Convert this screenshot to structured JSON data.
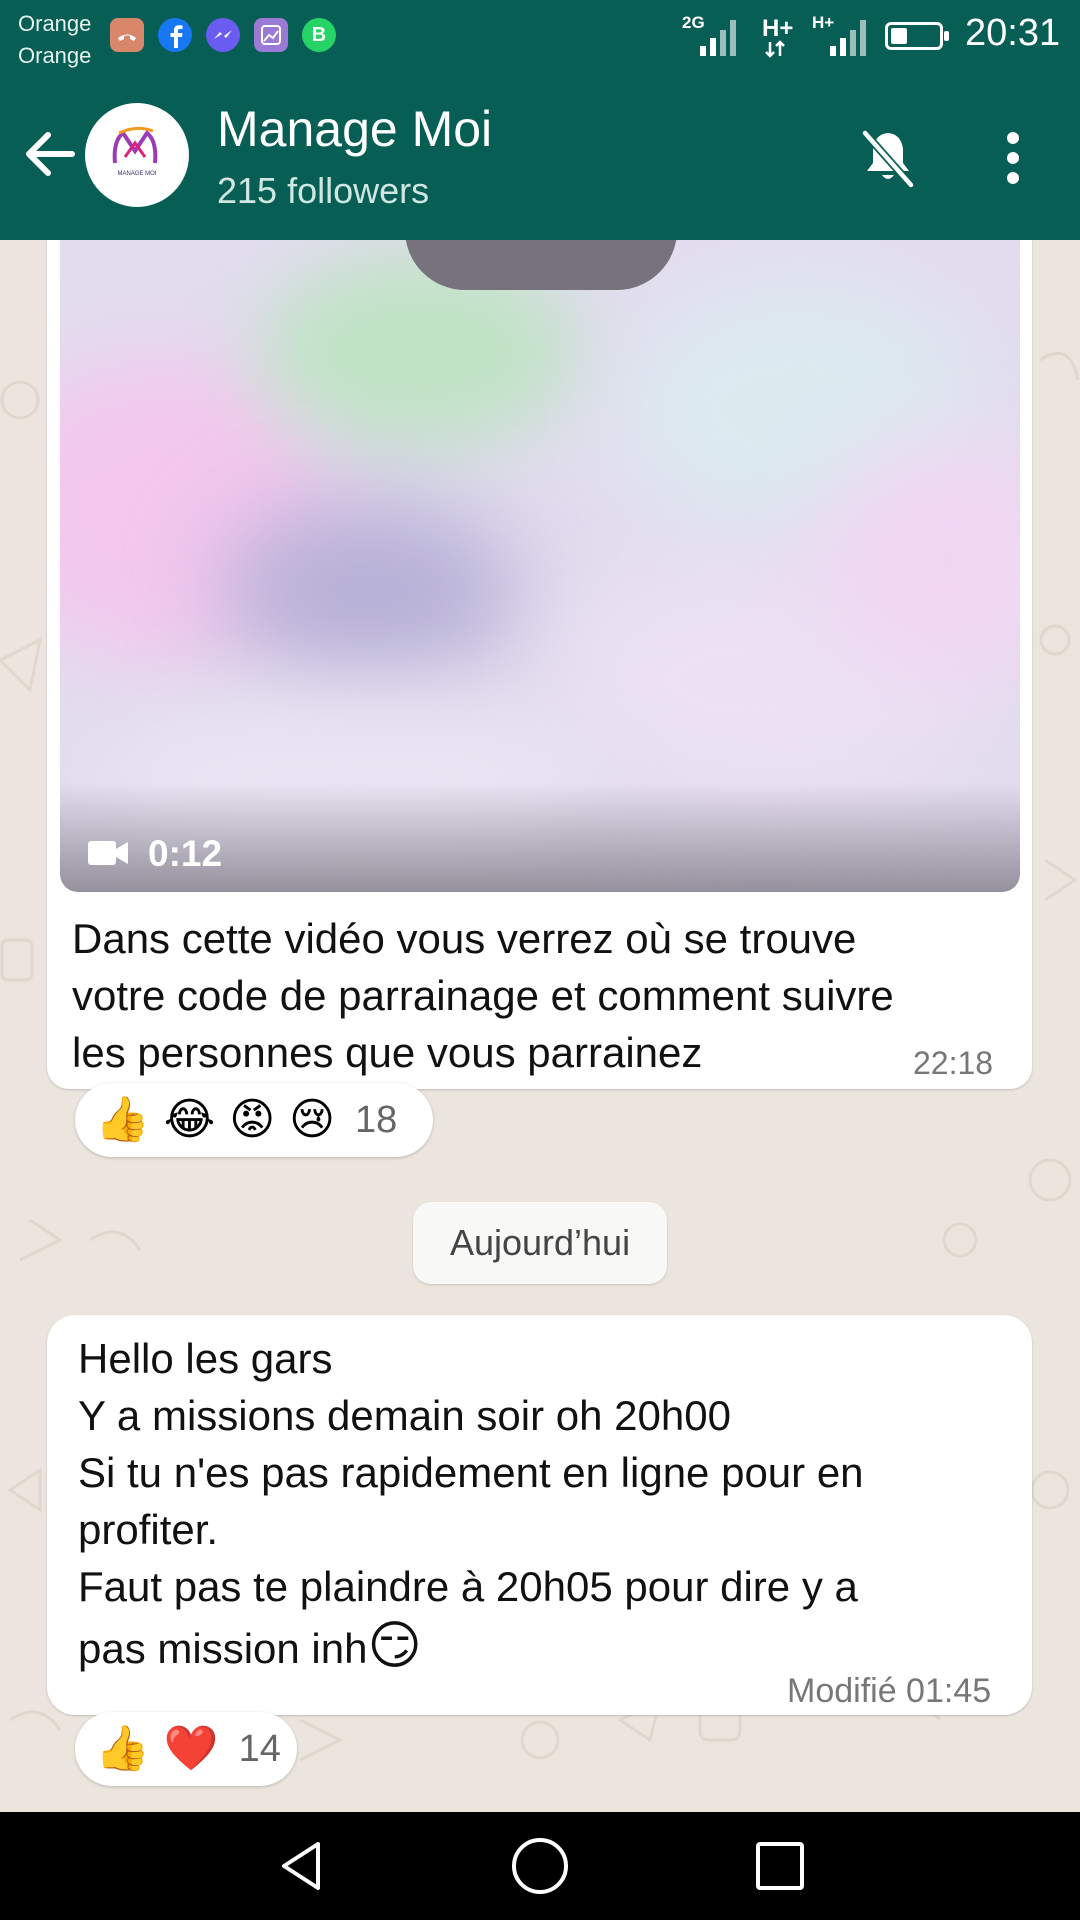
{
  "status_bar": {
    "carrier_1": "Orange",
    "carrier_2": "Orange",
    "net_1": "2G",
    "net_2": "H+",
    "net_3": "H+",
    "time": "20:31",
    "battery_level": 0.35,
    "notification_icons": [
      "missed-call-icon",
      "facebook-icon",
      "messenger-icon",
      "gallery-icon",
      "whatsapp-business-icon"
    ]
  },
  "header": {
    "title": "Manage Moi",
    "subtitle": "215 followers",
    "logo_text": "MANAGE MOI"
  },
  "messages": [
    {
      "video_duration": "0:12",
      "lines": [
        "Dans cette vidéo vous verrez où se trouve",
        "votre code de parrainage et comment suivre",
        "les personnes que vous parrainez"
      ],
      "time": "22:18",
      "reactions": [
        "👍",
        "😂",
        "😡",
        "😢"
      ],
      "reaction_count": "18"
    },
    {
      "lines": [
        "Hello les gars",
        "Y a missions demain soir oh 20h00",
        "Si tu n'es pas rapidement en ligne pour en",
        "profiter.",
        "Faut pas te plaindre à 20h05 pour dire y a",
        "pas mission inh"
      ],
      "trailing_emoji": "😏",
      "time": "Modifié 01:45",
      "reactions": [
        "👍",
        "❤️"
      ],
      "reaction_count": "14"
    }
  ],
  "day_separator": "Aujourd’hui",
  "colors": {
    "header": "#075e54",
    "chat_bg": "#ece5dd",
    "bubble": "#ffffff"
  }
}
